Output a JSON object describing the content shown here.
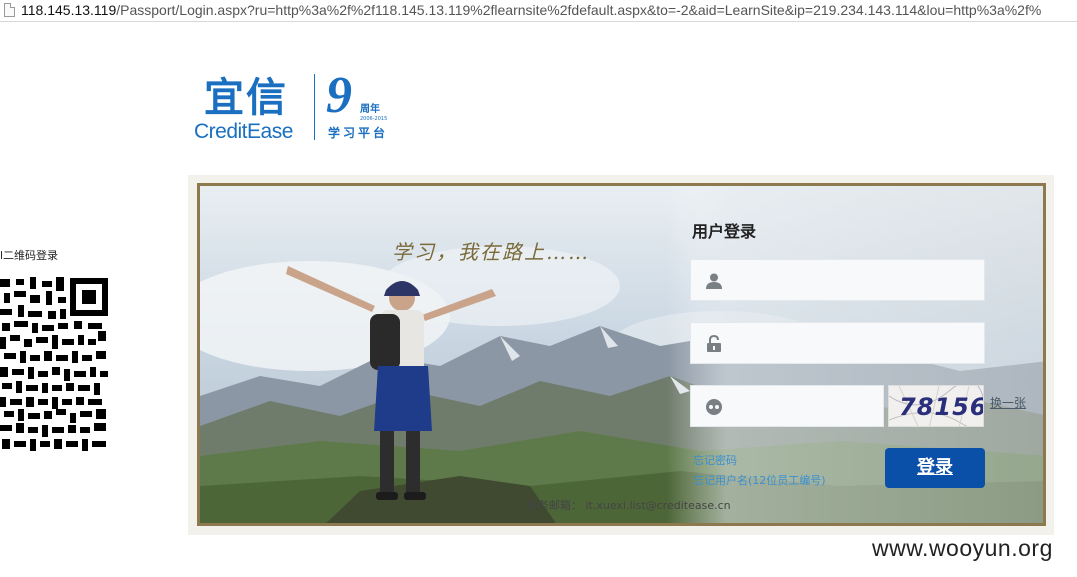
{
  "browser": {
    "url_host": "118.145.13.119",
    "url_rest": "/Passport/Login.aspx?ru=http%3a%2f%2f118.145.13.119%2flearnsite%2fdefault.aspx&to=-2&aid=LearnSite&ip=219.234.143.114&lou=http%3a%2f%"
  },
  "logo": {
    "cn": "宜信",
    "en": "CreditEase",
    "nine": "9",
    "anniv": "周年",
    "years": "2006-2015",
    "platform": "学习平台"
  },
  "qr": {
    "title": "l二维码登录"
  },
  "banner": {
    "slogan": "学习，我在路上……"
  },
  "login": {
    "title": "用户登录",
    "username_value": "",
    "password_value": "",
    "code_value": "",
    "captcha_text": "78156",
    "refresh_label": "换一张",
    "forgot_password": "忘记密码",
    "forgot_username": "忘记用户名(12位员工编号)",
    "submit_label": "登录",
    "service_email": "服务邮箱： it.xuexi.list@creditease.cn"
  },
  "watermark": "www.wooyun.org",
  "colors": {
    "brand_blue": "#1a6fc0",
    "button_blue": "#0a4fa8",
    "frame_border": "#8c7a4e",
    "link_blue": "#3a8fd0"
  },
  "icons": [
    "page-icon",
    "user-icon",
    "lock-icon",
    "captcha-icon",
    "qr-code-icon"
  ]
}
